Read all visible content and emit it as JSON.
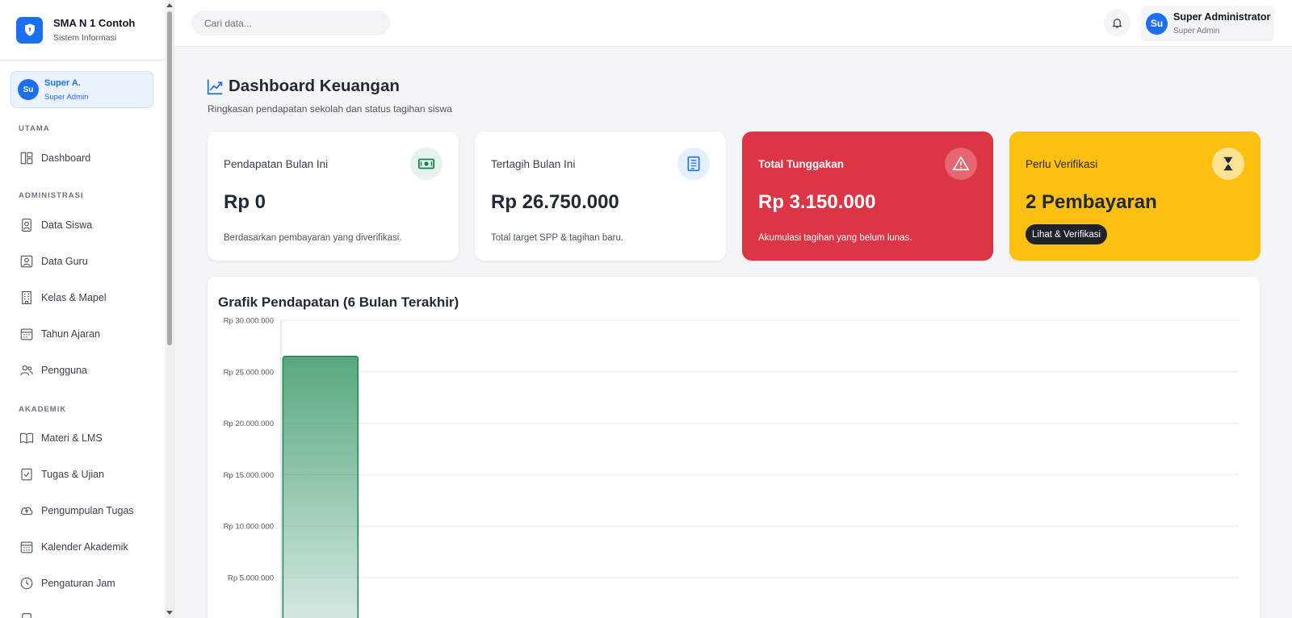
{
  "brand": {
    "name": "SMA N 1 Contoh",
    "subtitle": "Sistem Informasi"
  },
  "sidebar": {
    "user": {
      "initials": "Su",
      "name": "Super A.",
      "role": "Super Admin"
    },
    "sections": [
      {
        "label": "UTAMA",
        "items": [
          {
            "label": "Dashboard",
            "icon": "dashboard-icon"
          }
        ]
      },
      {
        "label": "ADMINISTRASI",
        "items": [
          {
            "label": "Data Siswa",
            "icon": "student-icon"
          },
          {
            "label": "Data Guru",
            "icon": "teacher-icon"
          },
          {
            "label": "Kelas & Mapel",
            "icon": "building-icon"
          },
          {
            "label": "Tahun Ajaran",
            "icon": "calendar-icon"
          },
          {
            "label": "Pengguna",
            "icon": "users-icon"
          }
        ]
      },
      {
        "label": "AKADEMIK",
        "items": [
          {
            "label": "Materi & LMS",
            "icon": "book-icon"
          },
          {
            "label": "Tugas & Ujian",
            "icon": "checklist-icon"
          },
          {
            "label": "Pengumpulan Tugas",
            "icon": "cloud-upload-icon"
          },
          {
            "label": "Kalender Akademik",
            "icon": "calendar-grid-icon"
          },
          {
            "label": "Pengaturan Jam",
            "icon": "clock-icon"
          }
        ]
      }
    ]
  },
  "header": {
    "search_placeholder": "Cari data...",
    "user": {
      "initials": "Su",
      "name": "Super Administrator",
      "role": "Super Admin"
    }
  },
  "page": {
    "title": "Dashboard Keuangan",
    "subtitle": "Ringkasan pendapatan sekolah dan status tagihan siswa"
  },
  "cards": [
    {
      "label": "Pendapatan Bulan Ini",
      "value": "Rp 0",
      "note": "Berdasarkan pembayaran yang diverifikasi.",
      "icon": "money-icon",
      "color": "#ffffff"
    },
    {
      "label": "Tertagih Bulan Ini",
      "value": "Rp 26.750.000",
      "note": "Total target SPP & tagihan baru.",
      "icon": "receipt-icon",
      "color": "#ffffff"
    },
    {
      "label": "Total Tunggakan",
      "value": "Rp 3.150.000",
      "note": "Akumulasi tagihan yang belum lunas.",
      "icon": "warning-icon",
      "color": "#dc3545"
    },
    {
      "label": "Perlu Verifikasi",
      "value": "2 Pembayaran",
      "button": "Lihat & Verifikasi",
      "icon": "hourglass-icon",
      "color": "#fdc010"
    }
  ],
  "chart_data": {
    "type": "bar",
    "title": "Grafik Pendapatan (6 Bulan Terakhir)",
    "ylim": [
      0,
      30000000
    ],
    "yticks": [
      "Rp 5.000.000",
      "Rp 10.000.000",
      "Rp 15.000.000",
      "Rp 20.000.000",
      "Rp 25.000.000",
      "Rp 30.000.000"
    ],
    "ytick_values": [
      5000000,
      10000000,
      15000000,
      20000000,
      25000000,
      30000000
    ],
    "values": [
      26500000,
      0,
      0,
      0,
      0,
      0
    ],
    "grid": true,
    "bar_color": "#4fa37a"
  }
}
